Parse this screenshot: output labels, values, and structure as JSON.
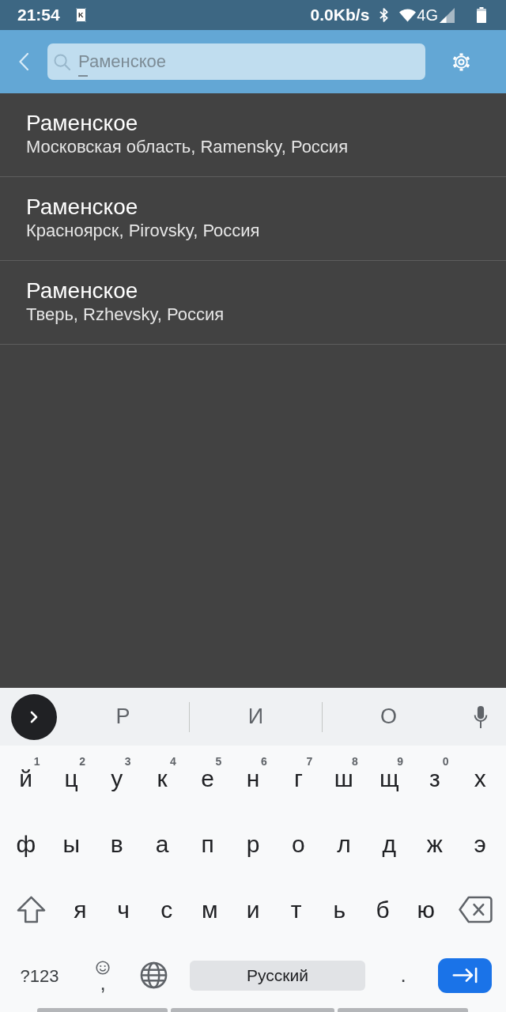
{
  "status_bar": {
    "time": "21:54",
    "notification": "K",
    "network_speed": "0.0Kb/s",
    "network_type": "4G"
  },
  "app_bar": {
    "search": {
      "value": "Раменское",
      "composing": true
    }
  },
  "results": [
    {
      "title": "Раменское",
      "subtitle": "Московская область, Ramensky, Россия"
    },
    {
      "title": "Раменское",
      "subtitle": "Красноярск, Pirovsky, Россия"
    },
    {
      "title": "Раменское",
      "subtitle": "Тверь, Rzhevsky, Россия"
    }
  ],
  "keyboard": {
    "suggestions": [
      "Р",
      "И",
      "О"
    ],
    "rows": [
      [
        {
          "kind": "letter",
          "label": "й",
          "hint": "1"
        },
        {
          "kind": "letter",
          "label": "ц",
          "hint": "2"
        },
        {
          "kind": "letter",
          "label": "у",
          "hint": "3"
        },
        {
          "kind": "letter",
          "label": "к",
          "hint": "4"
        },
        {
          "kind": "letter",
          "label": "е",
          "hint": "5"
        },
        {
          "kind": "letter",
          "label": "н",
          "hint": "6"
        },
        {
          "kind": "letter",
          "label": "г",
          "hint": "7"
        },
        {
          "kind": "letter",
          "label": "ш",
          "hint": "8"
        },
        {
          "kind": "letter",
          "label": "щ",
          "hint": "9"
        },
        {
          "kind": "letter",
          "label": "з",
          "hint": "0"
        },
        {
          "kind": "letter",
          "label": "х"
        }
      ],
      [
        {
          "kind": "letter",
          "label": "ф"
        },
        {
          "kind": "letter",
          "label": "ы"
        },
        {
          "kind": "letter",
          "label": "в"
        },
        {
          "kind": "letter",
          "label": "а"
        },
        {
          "kind": "letter",
          "label": "п"
        },
        {
          "kind": "letter",
          "label": "р"
        },
        {
          "kind": "letter",
          "label": "о"
        },
        {
          "kind": "letter",
          "label": "л"
        },
        {
          "kind": "letter",
          "label": "д"
        },
        {
          "kind": "letter",
          "label": "ж"
        },
        {
          "kind": "letter",
          "label": "э"
        }
      ],
      [
        {
          "kind": "shift"
        },
        {
          "kind": "letter",
          "label": "я"
        },
        {
          "kind": "letter",
          "label": "ч"
        },
        {
          "kind": "letter",
          "label": "с"
        },
        {
          "kind": "letter",
          "label": "м"
        },
        {
          "kind": "letter",
          "label": "и"
        },
        {
          "kind": "letter",
          "label": "т"
        },
        {
          "kind": "letter",
          "label": "ь"
        },
        {
          "kind": "letter",
          "label": "б"
        },
        {
          "kind": "letter",
          "label": "ю"
        },
        {
          "kind": "backspace"
        }
      ]
    ],
    "bottom_row": [
      {
        "kind": "symbols",
        "label": "?123"
      },
      {
        "kind": "emoji_comma",
        "label": ","
      },
      {
        "kind": "globe"
      },
      {
        "kind": "space",
        "label": "Русский"
      },
      {
        "kind": "period",
        "label": "."
      },
      {
        "kind": "enter"
      }
    ]
  }
}
